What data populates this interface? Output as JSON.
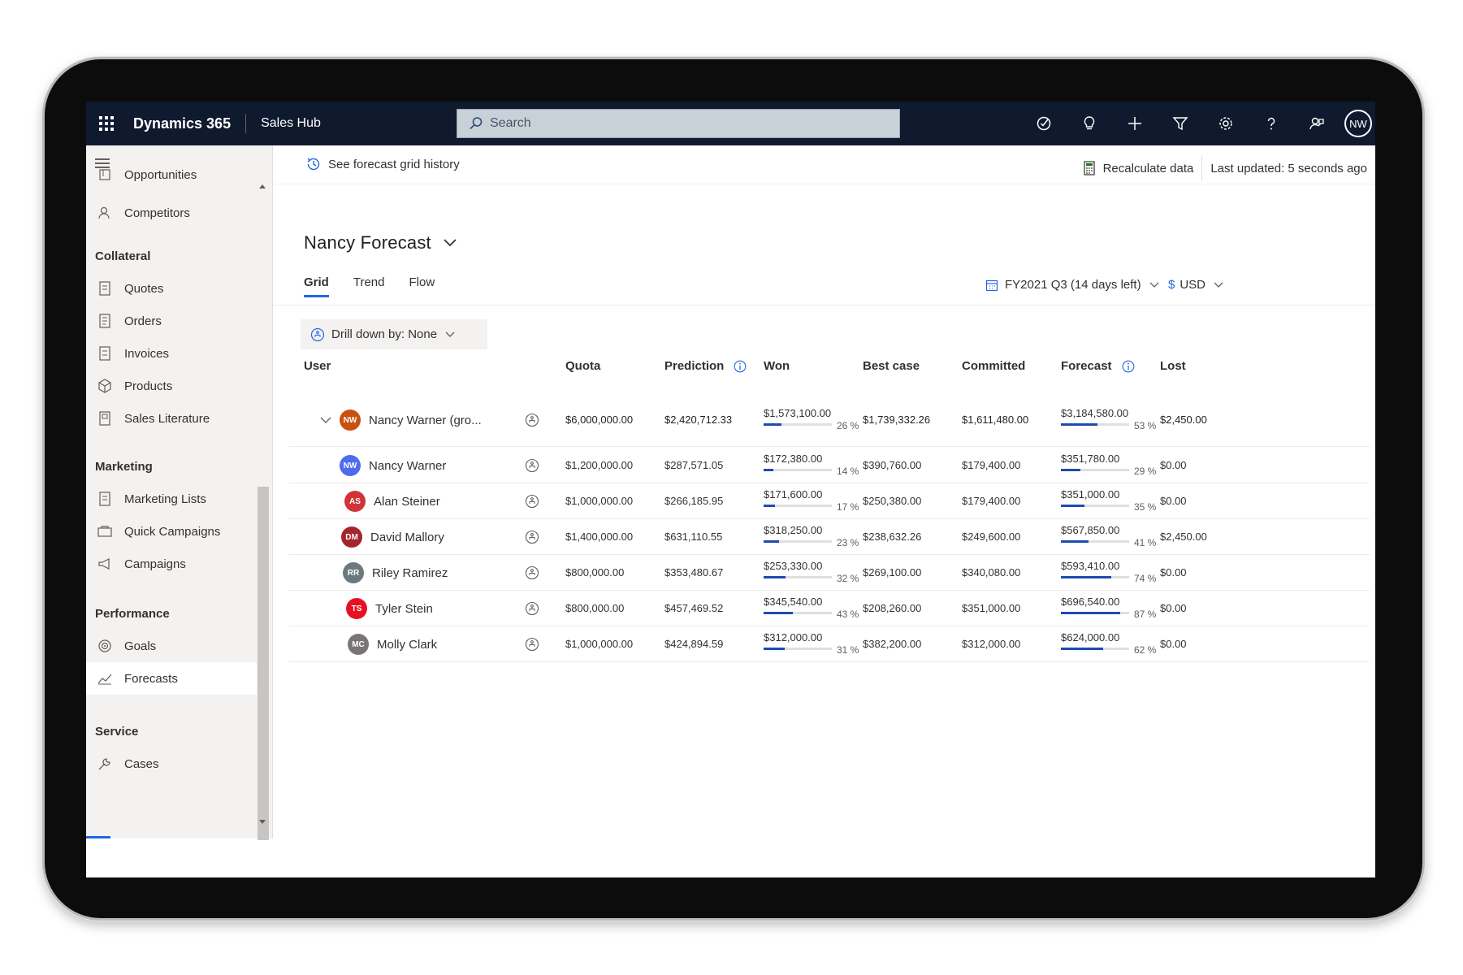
{
  "topbar": {
    "brand": "Dynamics 365",
    "app_name": "Sales Hub",
    "search_placeholder": "Search",
    "avatar_initials": "NW",
    "icons": [
      "task-check-icon",
      "lightbulb-icon",
      "plus-icon",
      "filter-icon",
      "gear-icon",
      "help-icon",
      "feedback-icon"
    ]
  },
  "sidebar": {
    "items_top": [
      {
        "label": "Opportunities",
        "icon": "opportunities-icon"
      },
      {
        "label": "Competitors",
        "icon": "competitors-icon"
      }
    ],
    "groups": [
      {
        "title": "Collateral",
        "items": [
          "Quotes",
          "Orders",
          "Invoices",
          "Products",
          "Sales Literature"
        ]
      },
      {
        "title": "Marketing",
        "items": [
          "Marketing Lists",
          "Quick Campaigns",
          "Campaigns"
        ]
      },
      {
        "title": "Performance",
        "items": [
          "Goals",
          "Forecasts"
        ]
      },
      {
        "title": "Service",
        "items": [
          "Cases"
        ]
      }
    ],
    "active": "Forecasts"
  },
  "cmdbar": {
    "history": "See forecast grid history",
    "recalculate": "Recalculate data",
    "last_updated": "Last updated: 5 seconds ago"
  },
  "page": {
    "title": "Nancy Forecast",
    "tabs": [
      "Grid",
      "Trend",
      "Flow"
    ],
    "active_tab": "Grid",
    "period": "FY2021 Q3 (14 days left)",
    "currency_symbol": "$",
    "currency": "USD",
    "drill_down": "Drill down by: None"
  },
  "table": {
    "columns": [
      "User",
      "Quota",
      "Prediction",
      "Won",
      "Best case",
      "Committed",
      "Forecast",
      "Lost"
    ],
    "group_row": {
      "initials": "NW",
      "avatar_color": "#ca5010",
      "name": "Nancy Warner (gro...",
      "quota": "$6,000,000.00",
      "prediction": "$2,420,712.33",
      "won": "$1,573,100.00",
      "won_pct": 26,
      "won_pct_label": "26 %",
      "best_case": "$1,739,332.26",
      "committed": "$1,611,480.00",
      "forecast": "$3,184,580.00",
      "forecast_pct": 53,
      "forecast_pct_label": "53 %",
      "lost": "$2,450.00"
    },
    "rows": [
      {
        "initials": "NW",
        "avatar_color": "#4f6bed",
        "name": "Nancy Warner",
        "quota": "$1,200,000.00",
        "prediction": "$287,571.05",
        "won": "$172,380.00",
        "won_pct": 14,
        "won_pct_label": "14 %",
        "best_case": "$390,760.00",
        "committed": "$179,400.00",
        "forecast": "$351,780.00",
        "forecast_pct": 29,
        "forecast_pct_label": "29 %",
        "lost": "$0.00"
      },
      {
        "initials": "AS",
        "avatar_color": "#d13438",
        "name": "Alan Steiner",
        "quota": "$1,000,000.00",
        "prediction": "$266,185.95",
        "won": "$171,600.00",
        "won_pct": 17,
        "won_pct_label": "17 %",
        "best_case": "$250,380.00",
        "committed": "$179,400.00",
        "forecast": "$351,000.00",
        "forecast_pct": 35,
        "forecast_pct_label": "35 %",
        "lost": "$0.00"
      },
      {
        "initials": "DM",
        "avatar_color": "#a4262c",
        "name": "David Mallory",
        "quota": "$1,400,000.00",
        "prediction": "$631,110.55",
        "won": "$318,250.00",
        "won_pct": 23,
        "won_pct_label": "23 %",
        "best_case": "$238,632.26",
        "committed": "$249,600.00",
        "forecast": "$567,850.00",
        "forecast_pct": 41,
        "forecast_pct_label": "41 %",
        "lost": "$2,450.00"
      },
      {
        "initials": "RR",
        "avatar_color": "#69797e",
        "name": "Riley Ramirez",
        "quota": "$800,000.00",
        "prediction": "$353,480.67",
        "won": "$253,330.00",
        "won_pct": 32,
        "won_pct_label": "32 %",
        "best_case": "$269,100.00",
        "committed": "$340,080.00",
        "forecast": "$593,410.00",
        "forecast_pct": 74,
        "forecast_pct_label": "74 %",
        "lost": "$0.00"
      },
      {
        "initials": "TS",
        "avatar_color": "#e81123",
        "name": "Tyler Stein",
        "quota": "$800,000.00",
        "prediction": "$457,469.52",
        "won": "$345,540.00",
        "won_pct": 43,
        "won_pct_label": "43 %",
        "best_case": "$208,260.00",
        "committed": "$351,000.00",
        "forecast": "$696,540.00",
        "forecast_pct": 87,
        "forecast_pct_label": "87 %",
        "lost": "$0.00"
      },
      {
        "initials": "MC",
        "avatar_color": "#7a7574",
        "name": "Molly Clark",
        "quota": "$1,000,000.00",
        "prediction": "$424,894.59",
        "won": "$312,000.00",
        "won_pct": 31,
        "won_pct_label": "31 %",
        "best_case": "$382,200.00",
        "committed": "$312,000.00",
        "forecast": "$624,000.00",
        "forecast_pct": 62,
        "forecast_pct_label": "62 %",
        "lost": "$0.00"
      }
    ]
  },
  "colors": {
    "topbar": "#0f1a2f",
    "accent": "#2266e3",
    "progress": "#1e4bb0"
  }
}
